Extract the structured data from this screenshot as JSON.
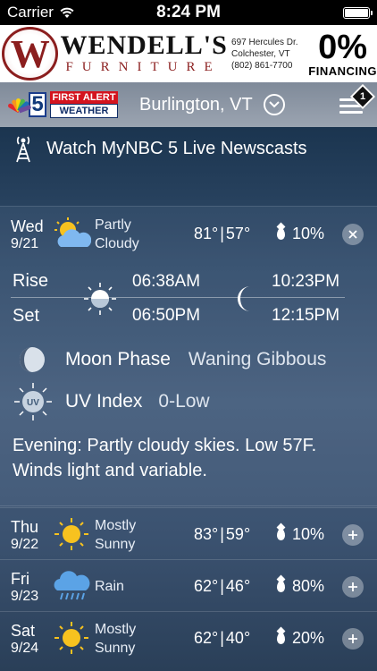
{
  "status_bar": {
    "carrier": "Carrier",
    "time": "8:24 PM"
  },
  "ad": {
    "logo_letter": "W",
    "name": "WENDELL'S",
    "subname": "FURNITURE",
    "address_line1": "697 Hercules Dr.",
    "address_line2": "Colchester, VT",
    "phone": "(802) 861-7700",
    "promo_percent": "0%",
    "promo_label": "FINANCING"
  },
  "header": {
    "station_logo": "NBC 5",
    "badge_top": "FIRST ALERT",
    "badge_bottom": "WEATHER",
    "location": "Burlington, VT",
    "notification_count": "1"
  },
  "watch_live": {
    "label": "Watch MyNBC 5 Live Newscasts",
    "icon": "broadcast-tower-icon"
  },
  "today": {
    "day": "Wed",
    "date": "9/21",
    "condition_line1": "Partly",
    "condition_line2": "Cloudy",
    "high": "81°",
    "low": "57°",
    "precip": "10%",
    "rise_label": "Rise",
    "set_label": "Set",
    "sunrise": "06:38AM",
    "sunset": "06:50PM",
    "moonrise": "10:23PM",
    "moonset": "12:15PM",
    "moon_phase_label": "Moon Phase",
    "moon_phase_value": "Waning Gibbous",
    "uv_label": "UV Index",
    "uv_value": "0-Low",
    "uv_icon_text": "UV",
    "description": "Evening: Partly cloudy skies. Low 57F. Winds light and variable."
  },
  "forecast": [
    {
      "day": "Thu",
      "date": "9/22",
      "cond1": "Mostly",
      "cond2": "Sunny",
      "high": "83°",
      "low": "59°",
      "precip": "10%",
      "icon": "sun-icon"
    },
    {
      "day": "Fri",
      "date": "9/23",
      "cond1": "Rain",
      "cond2": "",
      "high": "62°",
      "low": "46°",
      "precip": "80%",
      "icon": "rain-cloud-icon"
    },
    {
      "day": "Sat",
      "date": "9/24",
      "cond1": "Mostly",
      "cond2": "Sunny",
      "high": "62°",
      "low": "40°",
      "precip": "20%",
      "icon": "sun-icon"
    }
  ]
}
